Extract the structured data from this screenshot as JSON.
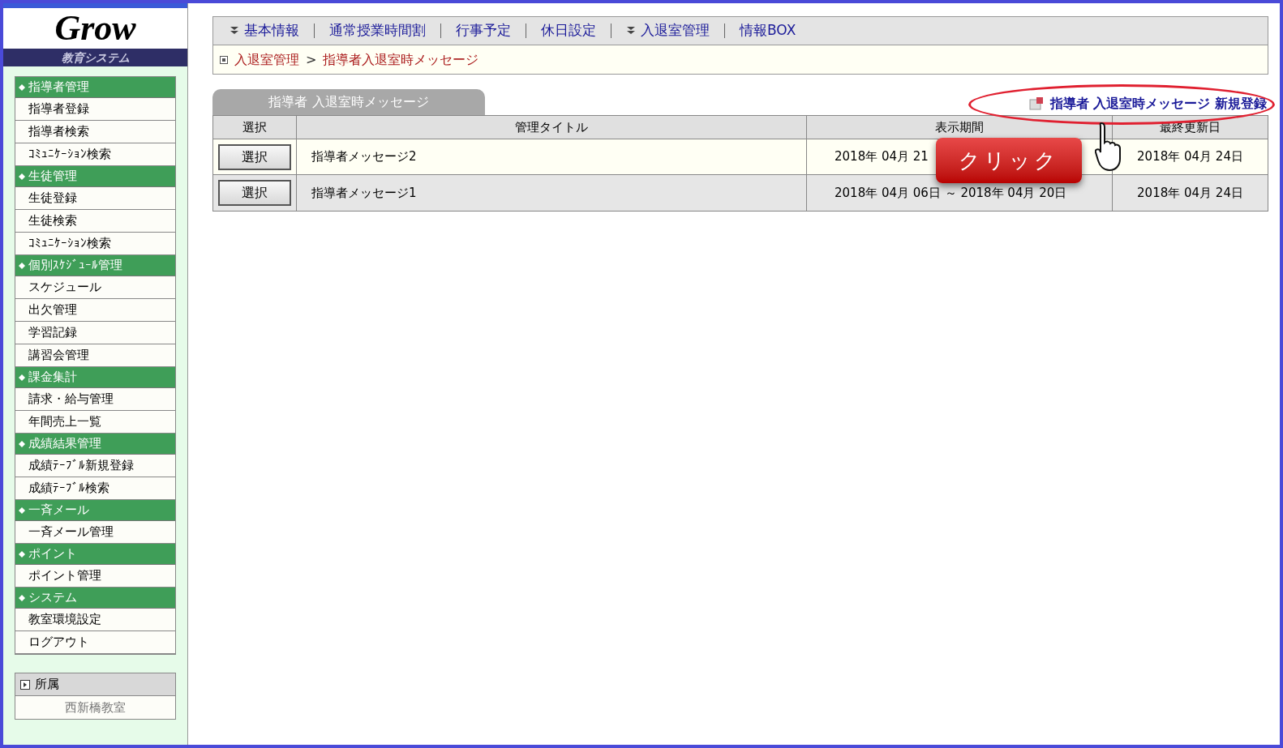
{
  "logo": {
    "name": "Grow",
    "subtitle": "教育システム"
  },
  "sidebar": [
    {
      "title": "指導者管理",
      "items": [
        "指導者登録",
        "指導者検索",
        "ｺﾐｭﾆｹｰｼｮﾝ検索"
      ]
    },
    {
      "title": "生徒管理",
      "items": [
        "生徒登録",
        "生徒検索",
        "ｺﾐｭﾆｹｰｼｮﾝ検索"
      ]
    },
    {
      "title": "個別ｽｹｼﾞｭｰﾙ管理",
      "items": [
        "スケジュール",
        "出欠管理",
        "学習記録",
        "講習会管理"
      ]
    },
    {
      "title": "課金集計",
      "items": [
        "請求・給与管理",
        "年間売上一覧"
      ]
    },
    {
      "title": "成績結果管理",
      "items": [
        "成績ﾃｰﾌﾞﾙ新規登録",
        "成績ﾃｰﾌﾞﾙ検索"
      ]
    },
    {
      "title": "一斉メール",
      "items": [
        "一斉メール管理"
      ]
    },
    {
      "title": "ポイント",
      "items": [
        "ポイント管理"
      ]
    },
    {
      "title": "システム",
      "items": [
        "教室環境設定",
        "ログアウト"
      ]
    }
  ],
  "affiliation": {
    "title": "所属",
    "value": "西新橋教室"
  },
  "nav": [
    {
      "label": "基本情報",
      "dropdown": true
    },
    {
      "label": "通常授業時間割",
      "dropdown": false
    },
    {
      "label": "行事予定",
      "dropdown": false
    },
    {
      "label": "休日設定",
      "dropdown": false
    },
    {
      "label": "入退室管理",
      "dropdown": true
    },
    {
      "label": "情報BOX",
      "dropdown": false
    }
  ],
  "breadcrumb": {
    "items": [
      "入退室管理",
      "指導者入退室時メッセージ"
    ],
    "separator": ">"
  },
  "panel": {
    "tab": "指導者 入退室時メッセージ",
    "new_link": "指導者 入退室時メッセージ 新規登録",
    "columns": [
      "選択",
      "管理タイトル",
      "表示期間",
      "最終更新日"
    ],
    "rows": [
      {
        "button": "選択",
        "title": "指導者メッセージ2",
        "period": "2018年 04月 21",
        "updated": "2018年 04月 24日"
      },
      {
        "button": "選択",
        "title": "指導者メッセージ1",
        "period": "2018年 04月 06日 ～ 2018年 04月 20日",
        "updated": "2018年 04月 24日"
      }
    ]
  },
  "annotation": {
    "callout": "クリック"
  }
}
